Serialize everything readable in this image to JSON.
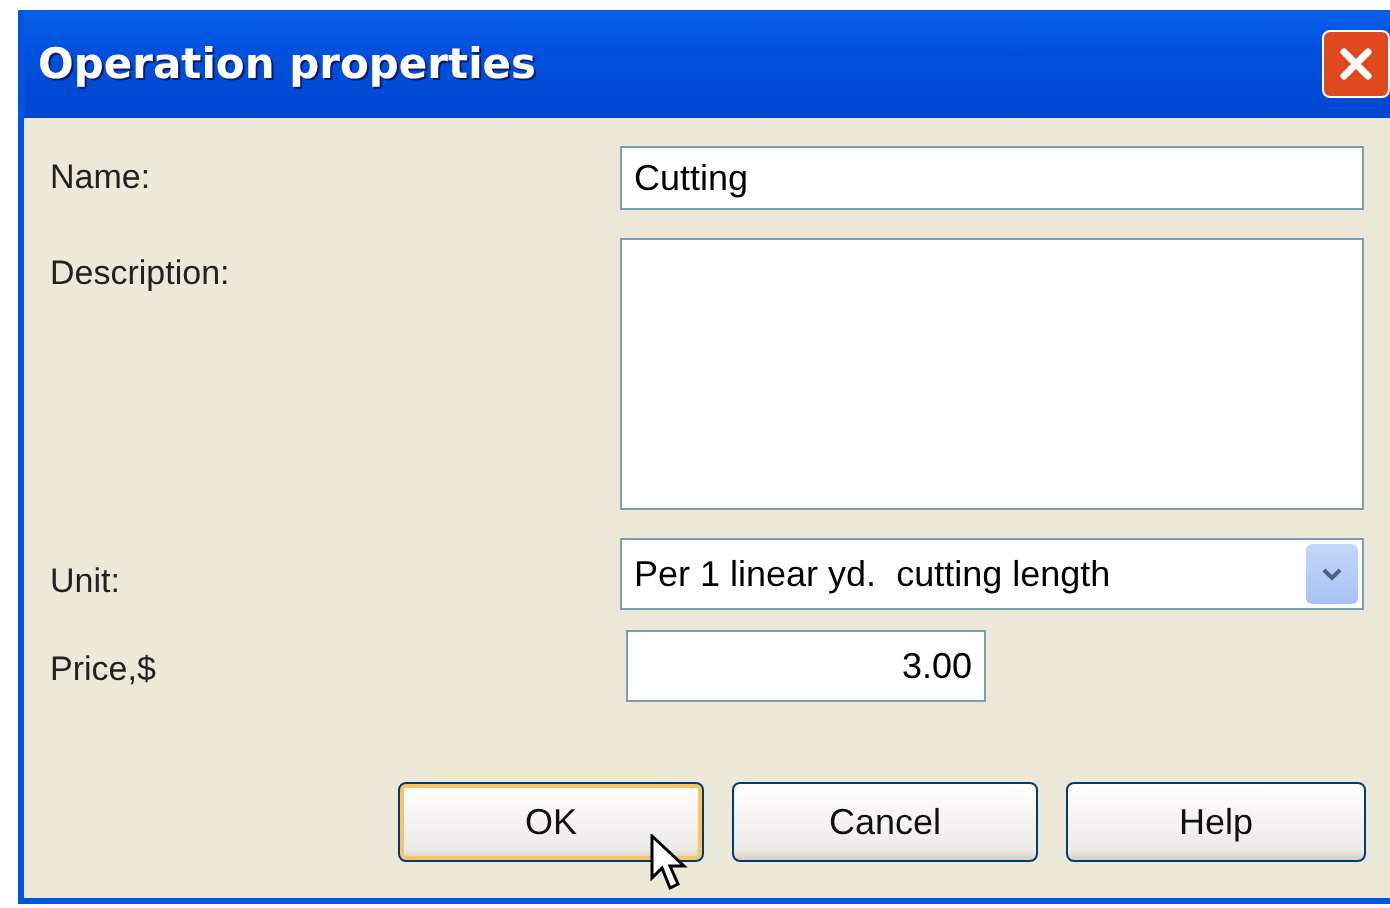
{
  "window": {
    "title": "Operation properties"
  },
  "fields": [
    {
      "kind": "text",
      "label": "Name:",
      "value": "Cutting"
    },
    {
      "kind": "textarea",
      "label": "Description:"
    },
    {
      "kind": "select",
      "label": "Unit:",
      "value": "Per 1 linear yd.  cutting length"
    },
    {
      "kind": "number",
      "label": "Price,$",
      "value": "3.00"
    }
  ],
  "buttons": [
    {
      "label": "OK",
      "default": true
    },
    {
      "label": "Cancel",
      "default": false
    },
    {
      "label": "Help",
      "default": false
    }
  ]
}
